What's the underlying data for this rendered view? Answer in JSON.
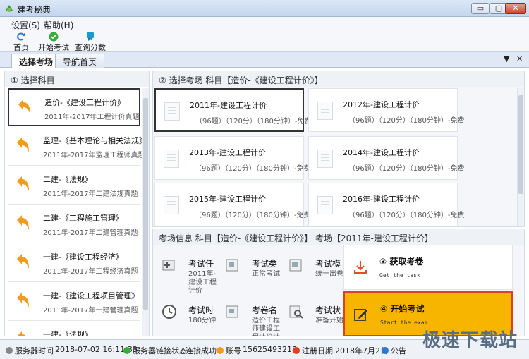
{
  "window": {
    "title": "建考秘典",
    "controls": [
      "▭",
      "▢",
      "✕"
    ]
  },
  "menu": {
    "settings": "设置(S)",
    "help": "帮助(H)"
  },
  "toolbar": {
    "home": "首页",
    "start_exam": "开始考试",
    "query_score": "查询分数"
  },
  "tabs": {
    "select": "选择考场",
    "nav_home": "导航首页",
    "pin": "▼",
    "close": "✕"
  },
  "subjects": {
    "header": "① 选择科目",
    "items": [
      {
        "name": "造价-《建设工程计价》",
        "sub": "2011年-2017年工程计价真题"
      },
      {
        "name": "监理-《基本理论与相关法规》",
        "sub": "2011年-2017年监理工程师真题"
      },
      {
        "name": "二建-《法规》",
        "sub": "2011年-2017年二建法规真题"
      },
      {
        "name": "二建-《工程施工管理》",
        "sub": "2011年-2017年二建管理真题"
      },
      {
        "name": "一建-《建设工程经济》",
        "sub": "2011年-2017年工程经济真题"
      },
      {
        "name": "一建-《建设工程项目管理》",
        "sub": "2011年-2017年一建管理真题"
      },
      {
        "name": "一建-《法规》",
        "sub": ""
      }
    ]
  },
  "exams": {
    "header": "② 选择考场   科目【造价-《建设工程计价》】",
    "items": [
      {
        "name": "2011年-建设工程计价",
        "detail": "（96题）（120分）（180分钟）-免费"
      },
      {
        "name": "2012年-建设工程计价",
        "detail": "（96题）（120分）（180分钟）-免费"
      },
      {
        "name": "2013年-建设工程计价",
        "detail": "（96题）（120分）（180分钟）-免费"
      },
      {
        "name": "2014年-建设工程计价",
        "detail": "（96题）（120分）（180分钟）-免费"
      },
      {
        "name": "2015年-建设工程计价",
        "detail": "（96题）（120分）（180分钟）-免费"
      },
      {
        "name": "2016年-建设工程计价",
        "detail": "（96题）（120分）（180分钟）-免费"
      }
    ]
  },
  "info": {
    "header": "考场信息   科目【造价-《建设工程计价》】   考场【2011年-建设工程计价】",
    "items": [
      {
        "label": "考试任",
        "value": "2011年-建设工程计价"
      },
      {
        "label": "考试类",
        "value": "正常考试"
      },
      {
        "label": "考试模",
        "value": "统一出卷"
      },
      {
        "label": "考试时",
        "value": "180分钟"
      },
      {
        "label": "考卷名",
        "value": "造价工程师建设工程计价计价"
      },
      {
        "label": "考试状",
        "value": "准备开始"
      }
    ],
    "get_task": {
      "title": "③ 获取考卷",
      "sub": "Get the task"
    },
    "start": {
      "title": "④ 开始考试",
      "sub": "Start the exam"
    }
  },
  "status": {
    "server_time_label": "服务器时间",
    "server_time": "2018-07-02 16:11:33",
    "conn_label": "服务器链接状态",
    "conn_value": "连接成功",
    "account_label": "账号",
    "account": "15625493218",
    "reg_label": "注册日期",
    "reg_date": "2018年7月2日",
    "notice": "公告"
  },
  "watermark": "极速下载站",
  "colors": {
    "accent": "#f7b500",
    "orange_arrow": "#f29b1c",
    "highlight_border": "#e04020"
  }
}
